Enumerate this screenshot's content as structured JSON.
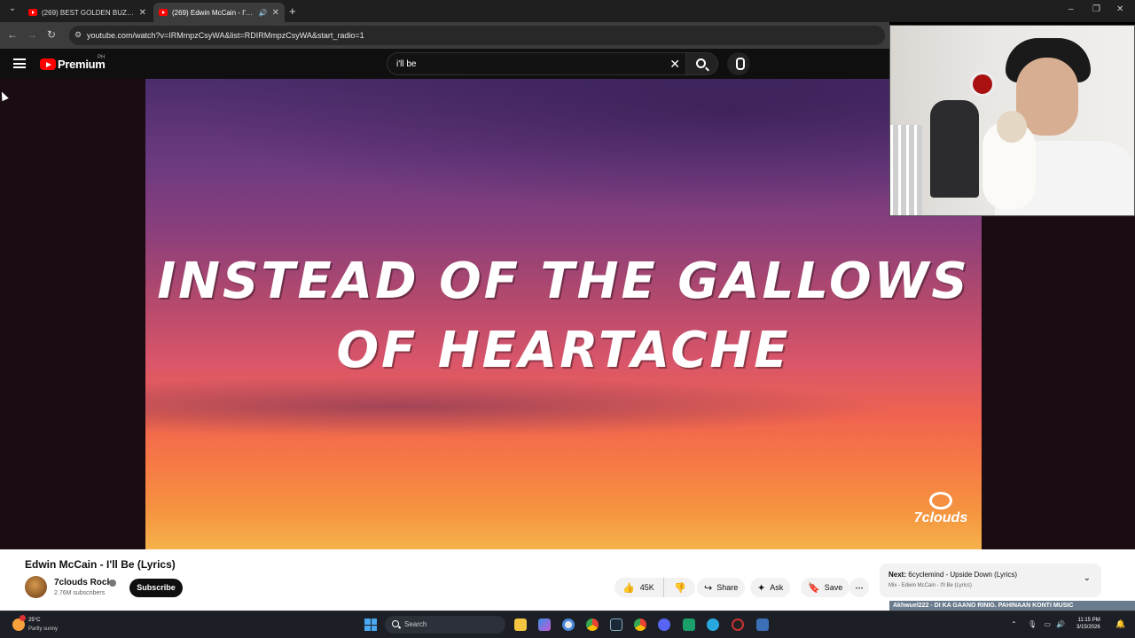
{
  "browser": {
    "tabs": [
      {
        "title": "(269) BEST GOLDEN BUZZER A..."
      },
      {
        "title": "(269) Edwin McCain - I'll Be..."
      }
    ],
    "new_tab": "+",
    "url": "youtube.com/watch?v=IRMmpzCsyWA&list=RDIRMmpzCsyWA&start_radio=1"
  },
  "youtube": {
    "brand": "Premium",
    "country": "PH",
    "search_value": "i'll be",
    "lyrics": [
      "INSTEAD OF THE GALLOWS",
      "OF HEARTACHE"
    ],
    "watermark": "7clouds",
    "video_title": "Edwin McCain - I'll Be (Lyrics)",
    "channel": {
      "name": "7clouds Rock",
      "subscribers": "2.76M subscribers"
    },
    "subscribe_label": "Subscribe",
    "actions": {
      "likes": "45K",
      "share": "Share",
      "ask": "Ask",
      "save": "Save",
      "more": "⋯"
    },
    "next": {
      "label": "Next:",
      "title": "6cyclemind - Upside Down (Lyrics)",
      "subtitle": "Mix - Edwin McCain - I'll Be (Lyrics)"
    }
  },
  "stream_overlay": {
    "ticker": "Akhwuel222 - DI KA GAANO RINIG. PAHINAAN KONTI MUSIC"
  },
  "taskbar": {
    "weather_temp": "25°C",
    "weather_desc": "Partly sunny",
    "search_label": "Search",
    "time": "11:15 PM",
    "date": "3/15/2026"
  },
  "colors": {
    "brand_red": "#ff0000",
    "yt_dark": "#0f0f0f",
    "chrome_bg": "#1f1f1f"
  }
}
